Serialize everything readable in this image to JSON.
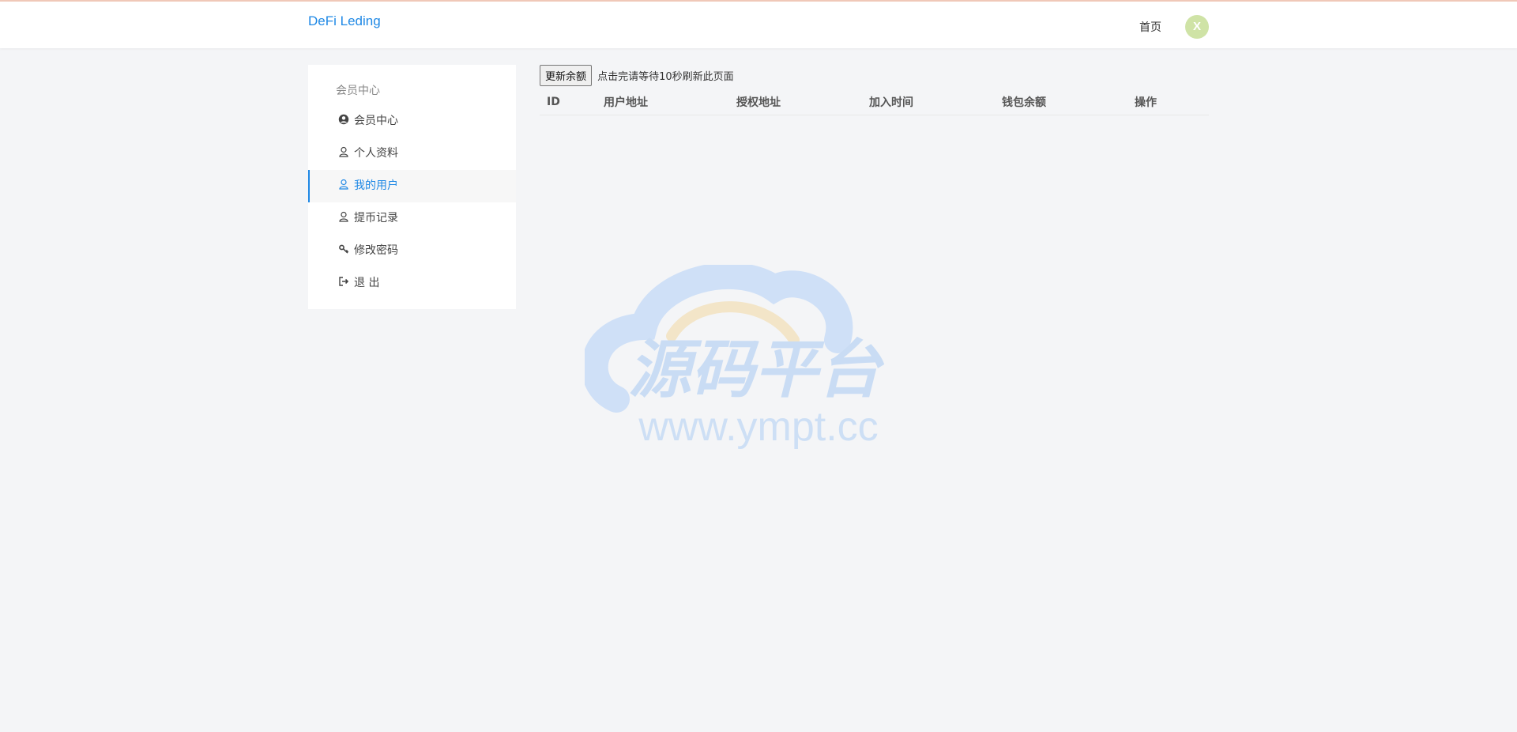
{
  "header": {
    "brand": "DeFi Leding",
    "home_label": "首页",
    "avatar_letter": "X"
  },
  "sidebar": {
    "title": "会员中心",
    "items": [
      {
        "label": "会员中心",
        "icon": "user-circle-icon"
      },
      {
        "label": "个人资料",
        "icon": "user-icon"
      },
      {
        "label": "我的用户",
        "icon": "user-icon",
        "active": true
      },
      {
        "label": "提币记录",
        "icon": "user-icon"
      },
      {
        "label": "修改密码",
        "icon": "key-icon"
      },
      {
        "label": "退 出",
        "icon": "sign-out-icon"
      }
    ]
  },
  "main": {
    "refresh_button": "更新余额",
    "hint": "点击完请等待10秒刷新此页面",
    "table": {
      "columns": [
        "ID",
        "用户地址",
        "授权地址",
        "加入时间",
        "钱包余额",
        "操作"
      ],
      "rows": []
    }
  },
  "watermark": {
    "title": "源码平台",
    "url": "www.ympt.cc"
  },
  "colors": {
    "accent": "#1e88e5",
    "background": "#f4f5f7",
    "avatar_bg": "#cfe3a6"
  }
}
